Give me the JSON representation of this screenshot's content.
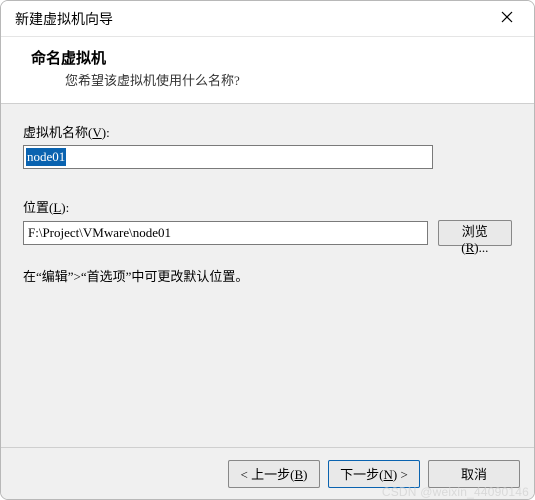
{
  "titlebar": {
    "title": "新建虚拟机向导"
  },
  "header": {
    "title": "命名虚拟机",
    "subtitle": "您希望该虚拟机使用什么名称?"
  },
  "fields": {
    "name": {
      "label_pre": "虚拟机名称(",
      "label_key": "V",
      "label_post": "):",
      "value": "node01"
    },
    "location": {
      "label_pre": "位置(",
      "label_key": "L",
      "label_post": "):",
      "value": "F:\\Project\\VMware\\node01",
      "browse_pre": "浏览(",
      "browse_key": "R",
      "browse_post": ")..."
    },
    "hint": "在“编辑”>“首选项”中可更改默认位置。"
  },
  "footer": {
    "back_pre": "< 上一步(",
    "back_key": "B",
    "back_post": ")",
    "next_pre": "下一步(",
    "next_key": "N",
    "next_post": ") >",
    "cancel": "取消"
  },
  "watermark": "CSDN @weixin_44090146"
}
